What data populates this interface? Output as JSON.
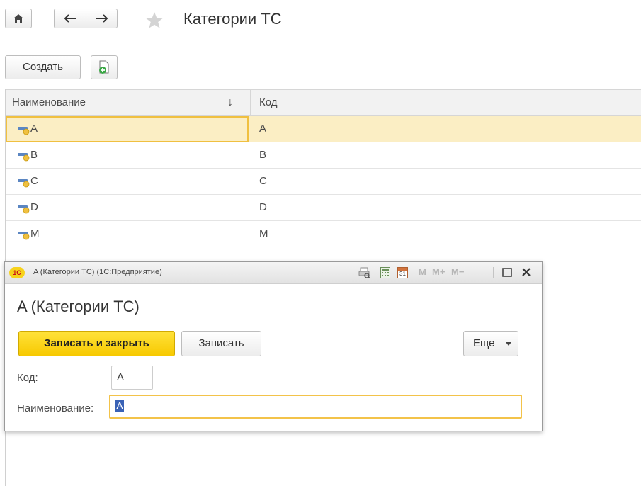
{
  "header": {
    "title": "Категории ТС"
  },
  "toolbar": {
    "create_label": "Создать"
  },
  "table": {
    "columns": {
      "name": "Наименование",
      "sort_arrow": "↓",
      "code": "Код"
    },
    "rows": [
      {
        "name": "A",
        "code": "A",
        "selected": true
      },
      {
        "name": "B",
        "code": "B",
        "selected": false
      },
      {
        "name": "C",
        "code": "C",
        "selected": false
      },
      {
        "name": "D",
        "code": "D",
        "selected": false
      },
      {
        "name": "M",
        "code": "M",
        "selected": false
      }
    ]
  },
  "form": {
    "window_title": "A (Категории ТС)  (1С:Предприятие)",
    "logo_text": "1С",
    "title": "A (Категории ТС)",
    "memory_buttons": [
      "M",
      "M+",
      "M−"
    ],
    "calendar_day": "31",
    "save_close_label": "Записать и закрыть",
    "save_label": "Записать",
    "more_label": "Еще",
    "code_label": "Код:",
    "code_value": "A",
    "name_label": "Наименование:",
    "name_value": "A"
  },
  "colors": {
    "selection_row": "#fbeec4",
    "primary_button": "#f7c900",
    "focus_border": "#f0c040"
  },
  "icons": [
    "home-icon",
    "back-arrow-icon",
    "forward-arrow-icon",
    "favorite-star-icon",
    "add-document-icon",
    "catalog-item-icon",
    "print-preview-icon",
    "calculator-icon",
    "calendar-icon",
    "maximize-icon",
    "close-icon",
    "dropdown-caret-icon"
  ]
}
